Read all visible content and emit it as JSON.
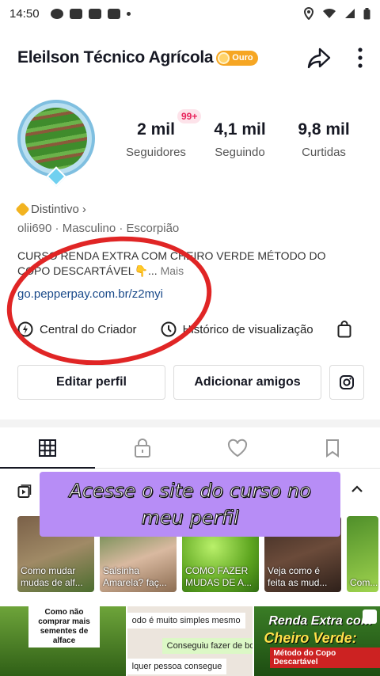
{
  "status_bar": {
    "time": "14:50"
  },
  "header": {
    "username": "Eleilson Técnico Agrícola",
    "badge_label": "Ouro"
  },
  "notifications": {
    "count": "99+"
  },
  "stats": [
    {
      "value": "2 mil",
      "label": "Seguidores"
    },
    {
      "value": "4,1 mil",
      "label": "Seguindo"
    },
    {
      "value": "9,8 mil",
      "label": "Curtidas"
    }
  ],
  "profile": {
    "distintivo": "Distintivo",
    "meta": "olii690 · Masculino · Escorpião",
    "bio": "CURSO RENDA EXTRA COM CHEIRO VERDE MÉTODO DO COPO DESCARTÁVEL👇...",
    "bio_more": "Mais",
    "link": "go.pepperpay.com.br/z2myi"
  },
  "tools": {
    "creator_center": "Central do Criador",
    "history": "Histórico de visualização"
  },
  "buttons": {
    "edit_profile": "Editar perfil",
    "add_friends": "Adicionar amigos"
  },
  "overlay": {
    "line1": "Acesse o site do curso no",
    "line2": "meu perfil"
  },
  "thumbnails": [
    {
      "caption": "Como mudar mudas de alf..."
    },
    {
      "caption": "Salsinha Amarela? faç..."
    },
    {
      "caption": "COMO FAZER MUDAS DE A..."
    },
    {
      "caption": "Veja como é feita as mud..."
    },
    {
      "caption": "Com..."
    }
  ],
  "videos": {
    "v1_note": "Como não comprar mais sementes de alface",
    "v2_msg1": "odo é muito simples mesmo",
    "v2_msg2": "Conseguiu fazer de boa?",
    "v2_msg3": "lquer pessoa consegue",
    "v3_title1": "Renda Extra com",
    "v3_title2": "Cheiro Verde:",
    "v3_sub": "Método do Copo Descartável"
  },
  "colors": {
    "highlight_circle": "#e02525",
    "overlay_bg": "#b78df6",
    "link": "#1a4a8a",
    "notif_badge_text": "#e8245c"
  }
}
